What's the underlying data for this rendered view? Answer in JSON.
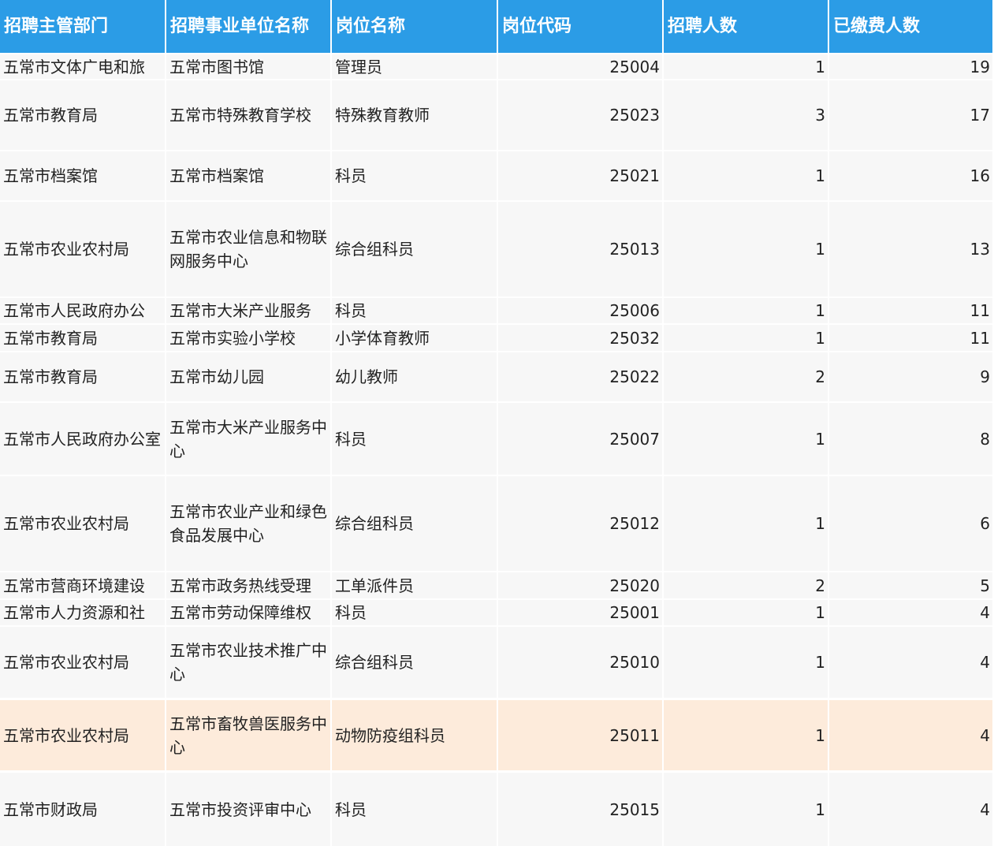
{
  "table": {
    "headers": [
      "招聘主管部门",
      "招聘事业单位名称",
      "岗位名称",
      "岗位代码",
      "招聘人数",
      "已缴费人数"
    ],
    "rows": [
      [
        "五常市文体广电和旅",
        "五常市图书馆",
        "管理员",
        "25004",
        "1",
        "19"
      ],
      [
        "五常市教育局",
        "五常市特殊教育学校",
        "特殊教育教师",
        "25023",
        "3",
        "17"
      ],
      [
        "五常市档案馆",
        "五常市档案馆",
        "科员",
        "25021",
        "1",
        "16"
      ],
      [
        "五常市农业农村局",
        "五常市农业信息和物联网服务中心",
        "综合组科员",
        "25013",
        "1",
        "13"
      ],
      [
        "五常市人民政府办公",
        "五常市大米产业服务",
        "科员",
        "25006",
        "1",
        "11"
      ],
      [
        "五常市教育局",
        "五常市实验小学校",
        "小学体育教师",
        "25032",
        "1",
        "11"
      ],
      [
        "五常市教育局",
        "五常市幼儿园",
        "幼儿教师",
        "25022",
        "2",
        "9"
      ],
      [
        "五常市人民政府办公室",
        "五常市大米产业服务中心",
        "科员",
        "25007",
        "1",
        "8"
      ],
      [
        "五常市农业农村局",
        "五常市农业产业和绿色食品发展中心",
        "综合组科员",
        "25012",
        "1",
        "6"
      ],
      [
        "五常市营商环境建设",
        "五常市政务热线受理",
        "工单派件员",
        "25020",
        "2",
        "5"
      ],
      [
        "五常市人力资源和社",
        "五常市劳动保障维权",
        "科员",
        "25001",
        "1",
        "4"
      ],
      [
        "五常市农业农村局",
        "五常市农业技术推广中心",
        "综合组科员",
        "25010",
        "1",
        "4"
      ],
      [
        "五常市农业农村局",
        "五常市畜牧兽医服务中心",
        "动物防疫组科员",
        "25011",
        "1",
        "4"
      ],
      [
        "五常市财政局",
        "五常市投资评审中心",
        "科员",
        "25015",
        "1",
        "4"
      ]
    ],
    "highlight_row": 12,
    "colors": {
      "header_bg": "#2b9ce6",
      "cell_bg": "#f7f7f7",
      "highlight_bg": "#fdebdb"
    }
  }
}
